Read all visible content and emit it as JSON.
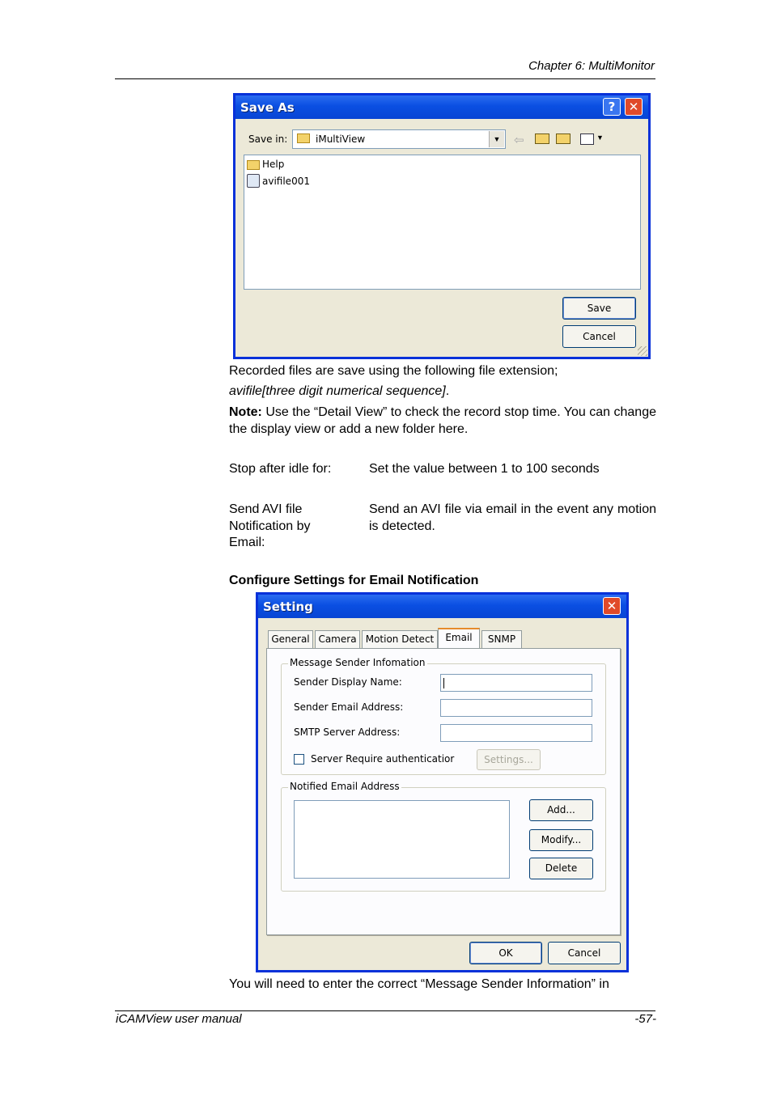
{
  "header": {
    "chapter": "Chapter 6: MultiMonitor"
  },
  "save_dialog": {
    "title": "Save As",
    "help_glyph": "?",
    "close_glyph": "✕",
    "save_in_label": "Save in:",
    "save_in_value": "iMultiView",
    "files": [
      {
        "name": "Help",
        "icon": "folder-icon"
      },
      {
        "name": "avifile001",
        "icon": "video-file-icon"
      }
    ],
    "save_button": "Save",
    "cancel_button": "Cancel"
  },
  "body": {
    "para1": "Recorded files are save using the following file extension;",
    "para1_ext": "avifile[three digit numerical sequence]",
    "para1_period": ".",
    "note_label": "Note:",
    "note_text": " Use the “Detail View” to check the record stop time. You can change the display view or add a new folder here.",
    "idle_term": "Stop after idle for:",
    "idle_desc": "Set the value between 1 to 100 seconds",
    "email_term_1": "Send AVI file",
    "email_term_2": "Notification by",
    "email_term_3": "Email:",
    "email_desc": "Send an AVI file via email in the event any motion is detected.",
    "section_heading": "Configure Settings for Email Notification",
    "bottom_text": "You will need to enter the correct “Message Sender Information” in"
  },
  "setting_dialog": {
    "title": "Setting",
    "close_glyph": "✕",
    "tabs": [
      "General",
      "Camera",
      "Motion Detect",
      "Email",
      "SNMP"
    ],
    "active_tab": "Email",
    "sender_group": "Message Sender Infomation",
    "sender_display_name": "Sender Display Name:",
    "sender_email": "Sender Email Address:",
    "smtp_server": "SMTP Server Address:",
    "auth_checkbox": "Server Require authenticatior",
    "settings_button": "Settings...",
    "notified_group": "Notified Email Address",
    "add_button": "Add...",
    "modify_button": "Modify...",
    "delete_button": "Delete",
    "ok_button": "OK",
    "cancel_button": "Cancel"
  },
  "footer": {
    "left": "iCAMView  user  manual",
    "right": "-57-"
  }
}
